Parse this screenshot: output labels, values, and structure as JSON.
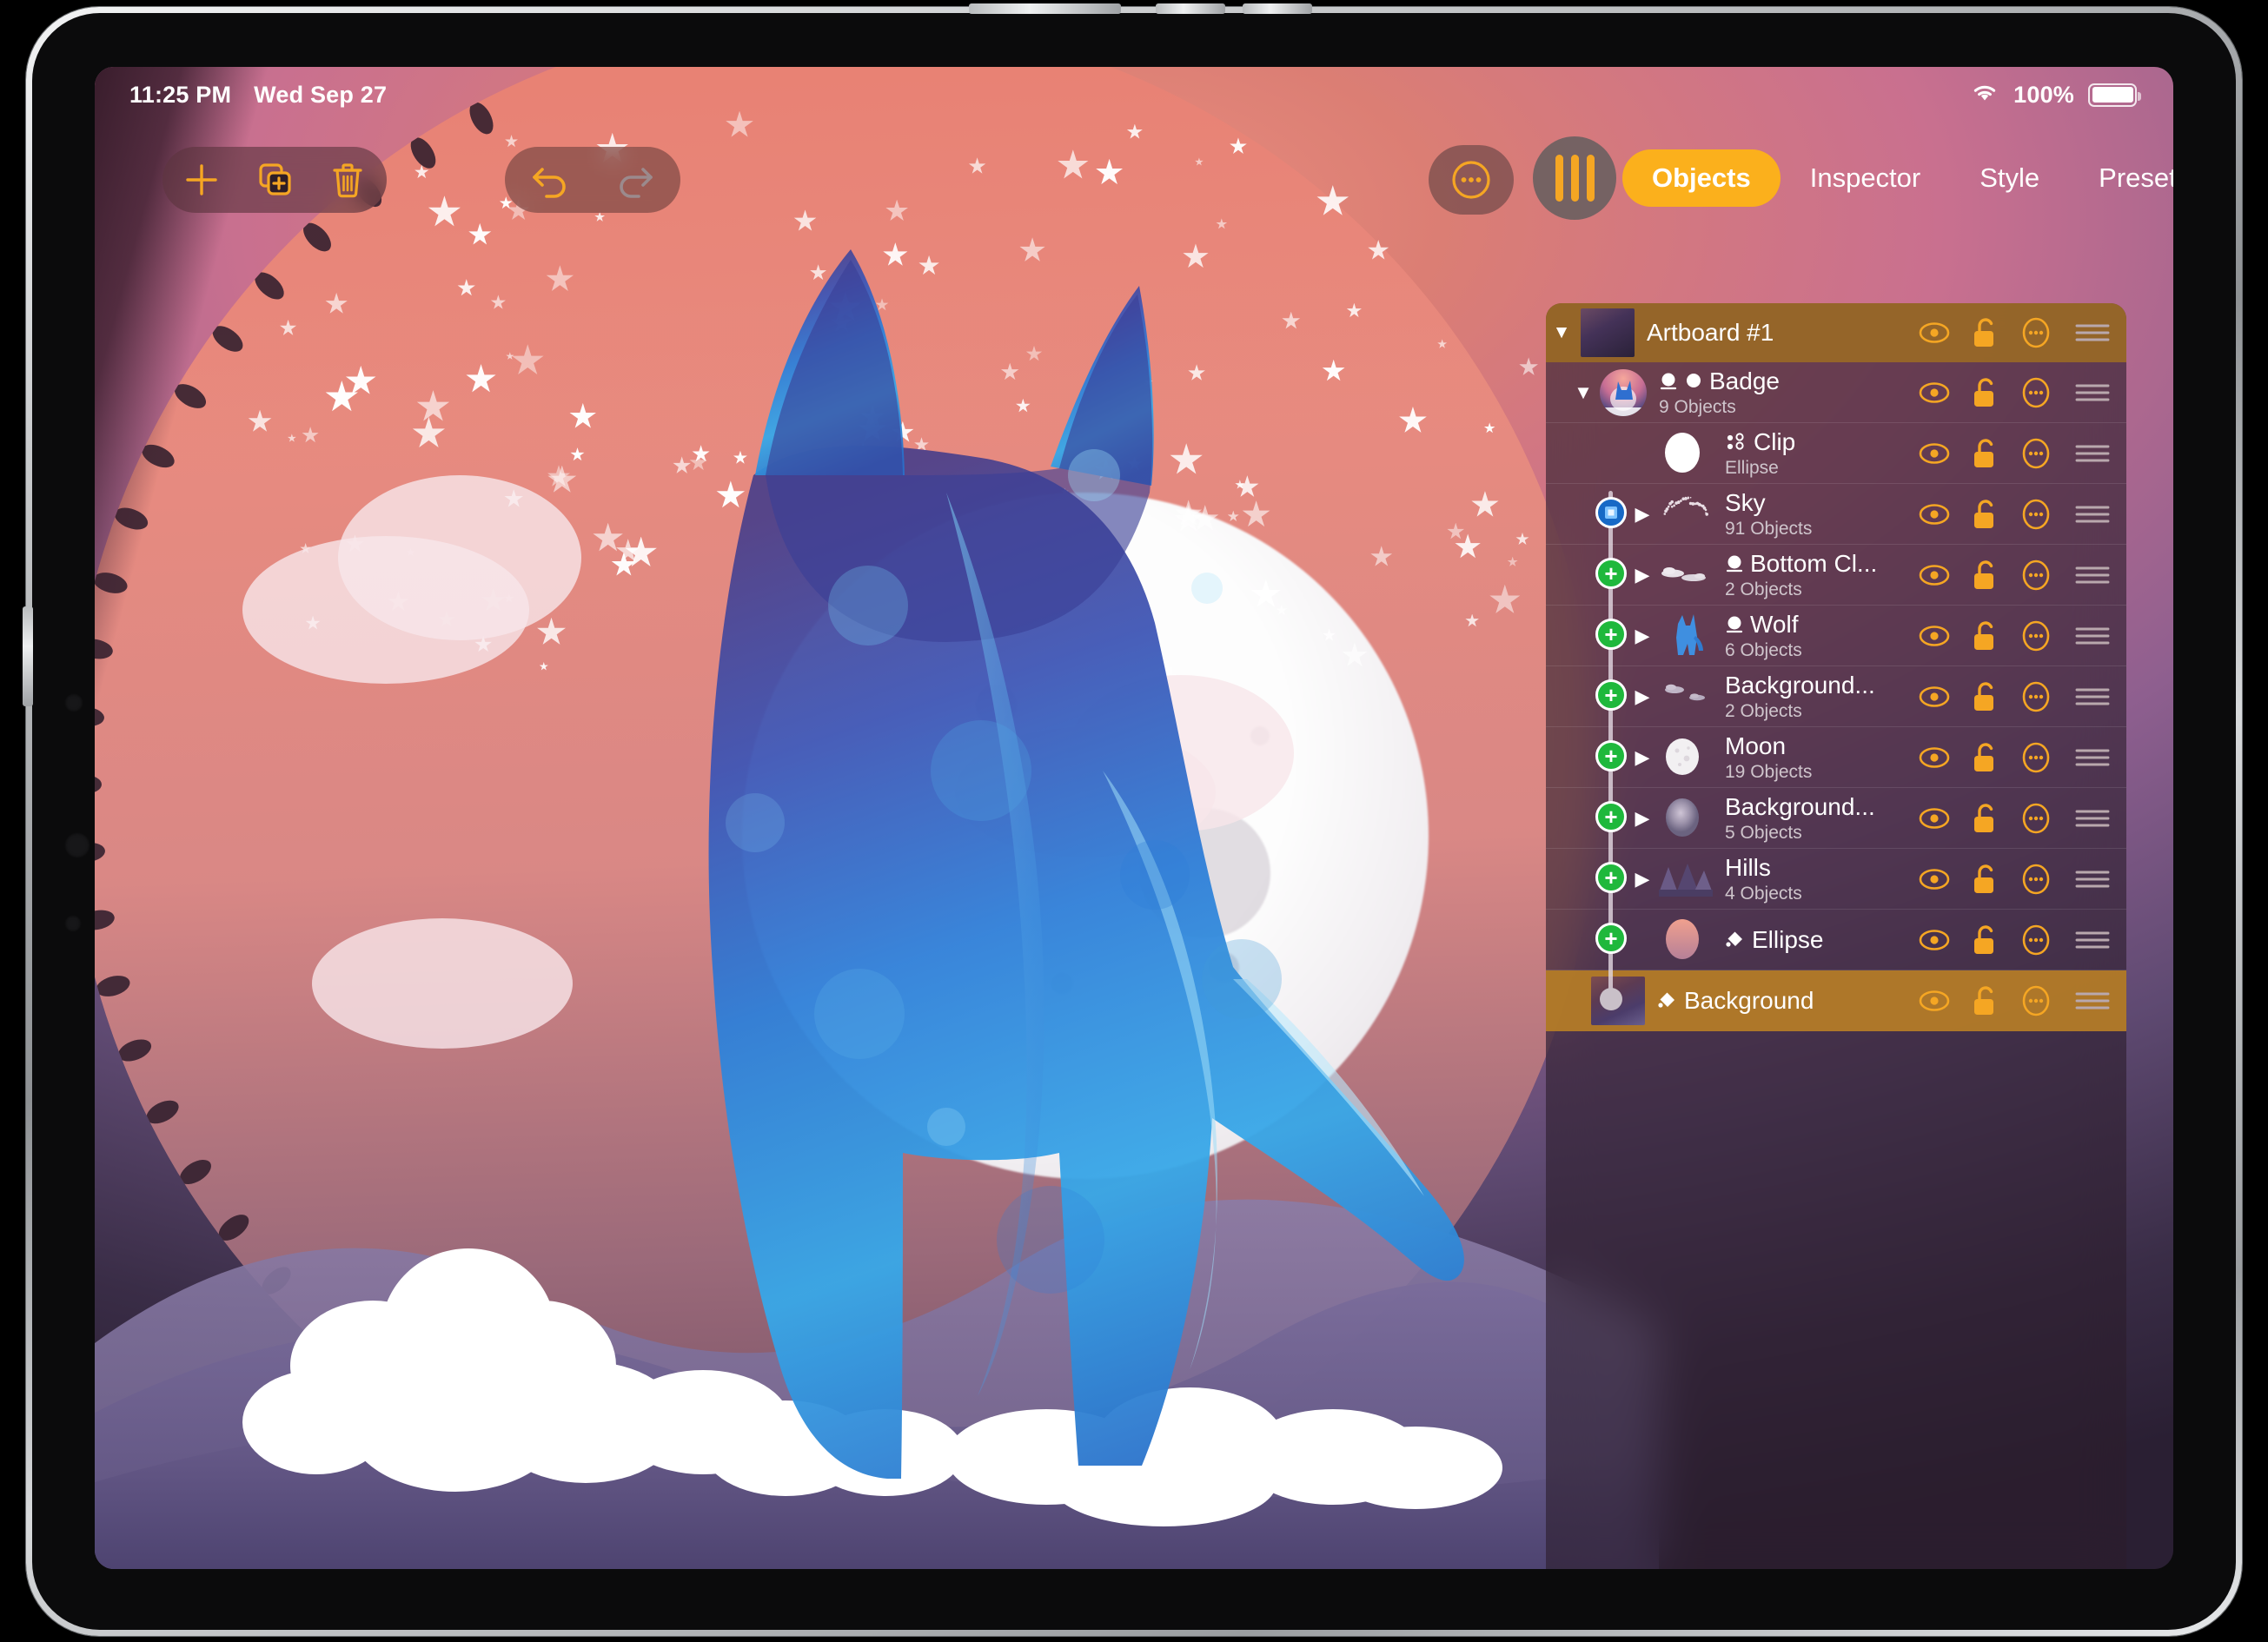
{
  "status_bar": {
    "time": "11:25 PM",
    "date": "Wed Sep 27",
    "wifi_icon": "wifi-icon",
    "battery_percent": "100%",
    "battery_icon": "battery-full-icon"
  },
  "toolbar": {
    "add_label": "+",
    "add_icon": "plus-icon",
    "duplicate_icon": "duplicate-artboard-icon",
    "delete_icon": "trash-icon",
    "undo_icon": "undo-arrow-icon",
    "redo_icon": "redo-arrow-icon",
    "more_icon": "more-circle-icon",
    "panels_icon": "panels-toggle-icon"
  },
  "tabs": [
    {
      "label": "Objects",
      "active": true
    },
    {
      "label": "Inspector",
      "active": false
    },
    {
      "label": "Style",
      "active": false
    },
    {
      "label": "Presets",
      "active": false
    }
  ],
  "layers_panel": {
    "artboard": {
      "name": "Artboard #1",
      "expanded": true,
      "visibility_icon": "eye-icon",
      "lock_icon": "unlocked-padlock-icon",
      "options_icon": "more-circle-icon",
      "reorder_icon": "drag-handle-icon"
    },
    "rows": [
      {
        "name": "Badge",
        "subtitle": "9 Objects",
        "depth": 0,
        "expanded": true,
        "has_disclosure": true,
        "node": "none",
        "badges": [
          "mask-icon",
          "blend-mode-icon"
        ],
        "thumb": "badge-thumbnail",
        "selected": false
      },
      {
        "name": "Clip",
        "subtitle": "Ellipse",
        "depth": 1,
        "expanded": false,
        "has_disclosure": false,
        "node": "mask",
        "badges": [
          "nodes-icon"
        ],
        "thumb": "white-ellipse-thumbnail",
        "selected": false
      },
      {
        "name": "Sky",
        "subtitle": "91 Objects",
        "depth": 1,
        "expanded": false,
        "has_disclosure": true,
        "node": "plus",
        "badges": [],
        "thumb": "stars-thumbnail",
        "selected": false
      },
      {
        "name": "Bottom Cl...",
        "subtitle": "2 Objects",
        "depth": 1,
        "expanded": false,
        "has_disclosure": true,
        "node": "plus",
        "badges": [
          "mask-icon"
        ],
        "thumb": "bottom-clouds-thumbnail",
        "selected": false
      },
      {
        "name": "Wolf",
        "subtitle": "6 Objects",
        "depth": 1,
        "expanded": false,
        "has_disclosure": true,
        "node": "plus",
        "badges": [
          "mask-icon"
        ],
        "thumb": "wolf-thumbnail",
        "selected": false
      },
      {
        "name": "Background...",
        "subtitle": "2 Objects",
        "depth": 1,
        "expanded": false,
        "has_disclosure": true,
        "node": "plus",
        "badges": [],
        "thumb": "background-clouds-thumbnail",
        "selected": false
      },
      {
        "name": "Moon",
        "subtitle": "19 Objects",
        "depth": 1,
        "expanded": false,
        "has_disclosure": true,
        "node": "plus",
        "badges": [],
        "thumb": "moon-thumbnail",
        "selected": false
      },
      {
        "name": "Background...",
        "subtitle": "5 Objects",
        "depth": 1,
        "expanded": false,
        "has_disclosure": true,
        "node": "plus",
        "badges": [],
        "thumb": "background-glow-thumbnail",
        "selected": false
      },
      {
        "name": "Hills",
        "subtitle": "4 Objects",
        "depth": 1,
        "expanded": false,
        "has_disclosure": true,
        "node": "plus",
        "badges": [],
        "thumb": "hills-thumbnail",
        "selected": false
      },
      {
        "name": "Ellipse",
        "subtitle": "",
        "depth": 1,
        "expanded": false,
        "has_disclosure": false,
        "node": "dot",
        "badges": [
          "fill-icon"
        ],
        "thumb": "pink-ellipse-thumbnail",
        "selected": false
      },
      {
        "name": "Background",
        "subtitle": "",
        "depth": 0,
        "expanded": false,
        "has_disclosure": false,
        "node": "none",
        "badges": [
          "fill-icon"
        ],
        "thumb": "background-thumbnail",
        "selected": true
      }
    ],
    "row_action_icons": {
      "visibility": "eye-icon",
      "lock": "unlocked-padlock-icon",
      "options": "more-circle-icon",
      "reorder": "drag-handle-icon"
    }
  },
  "artwork": {
    "title": "wolf-moon-badge-illustration",
    "description": "Stylized blue wolf silhouette in front of a full moon with a salmon-to-purple circular gradient sky, six-point stars, white clouds and purple hills."
  },
  "colors": {
    "accent_orange": "#fbb01c",
    "accent_orange_icon": "#f5a623",
    "selected_row": "#b27b28",
    "artboard_row": "#986826",
    "node_green": "#1fb83c",
    "node_blue": "#1769c6",
    "panel_bg": "rgba(44,29,44,0.62)",
    "text_primary": "#ffffff",
    "text_secondary": "#cfc5cc"
  }
}
